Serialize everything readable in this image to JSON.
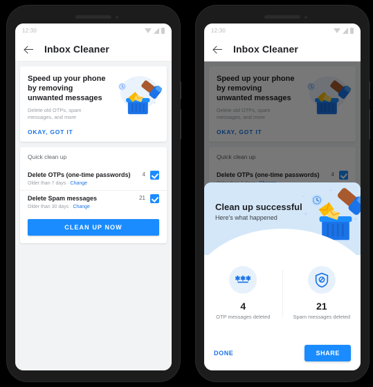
{
  "colors": {
    "accent_blue": "#1a8cff",
    "link_blue": "#1a73e8",
    "hero_bg": "#d3e7f9",
    "page_bg": "#f1f3f4",
    "frame": "#1c1c1c",
    "text_primary": "#202124",
    "text_secondary": "#5f6368",
    "text_muted": "#9aa0a6"
  },
  "status_bar": {
    "time": "12:30",
    "icons": [
      "wifi-icon",
      "signal-icon",
      "battery-icon"
    ]
  },
  "app_bar": {
    "back_icon": "back-arrow-icon",
    "title": "Inbox Cleaner"
  },
  "promo_card": {
    "title": "Speed up your phone by removing unwanted messages",
    "subtitle": "Delete old OTPs, spam messages, and more",
    "cta": "OKAY, GOT IT",
    "illustration": "hand-dumping-envelopes-into-trash-illustration"
  },
  "quick_clean": {
    "header": "Quick clean up",
    "rows": [
      {
        "name": "Delete OTPs (one-time passwords)",
        "meta_prefix": "Older than 7 days · ",
        "meta_link": "Change",
        "count": "4",
        "checked": true
      },
      {
        "name": "Delete Spam messages",
        "meta_prefix": "Older than 30 days · ",
        "meta_link": "Change",
        "count": "21",
        "checked": true
      }
    ],
    "primary_button": "CLEAN UP NOW"
  },
  "success_sheet": {
    "title": "Clean up successful",
    "subtitle": "Here's what happened",
    "illustration": "hand-dumping-envelopes-into-trash-illustration",
    "stats": [
      {
        "icon": "password-asterisks-icon",
        "number": "4",
        "label": "OTP messages deleted"
      },
      {
        "icon": "shield-block-icon",
        "number": "21",
        "label": "Spam messages deleted"
      }
    ],
    "done_label": "DONE",
    "share_label": "SHARE"
  }
}
